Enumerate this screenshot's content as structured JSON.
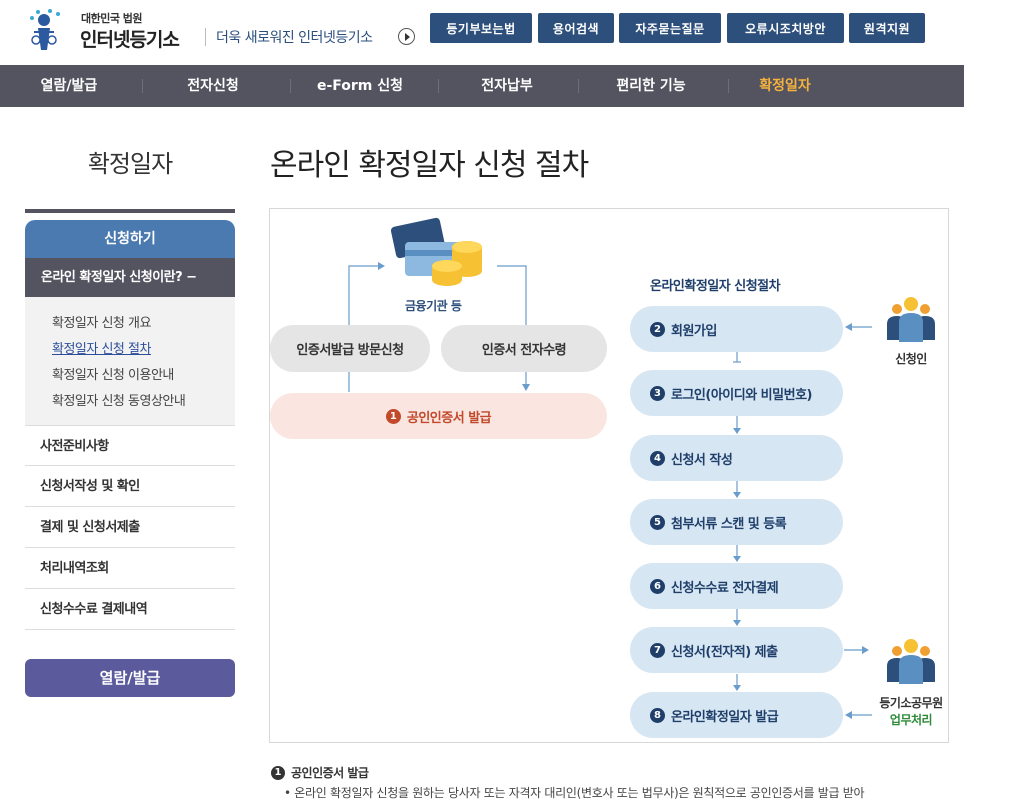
{
  "header": {
    "logo_small": "대한민국 법원",
    "logo_big": "인터넷등기소",
    "slogan": "더욱 새로워진 인터넷등기소",
    "top_buttons": [
      "등기부보는법",
      "용어검색",
      "자주묻는질문",
      "오류시조치방안",
      "원격지원"
    ]
  },
  "nav": {
    "items": [
      "열람/발급",
      "전자신청",
      "e-Form 신청",
      "전자납부",
      "편리한 기능",
      "확정일자"
    ],
    "active_index": 5
  },
  "sidebar": {
    "title": "확정일자",
    "apply_header": "신청하기",
    "active_item": "온라인 확정일자 신청이란? −",
    "sub_items": [
      "확정일자 신청 개요",
      "확정일자 신청 절차",
      "확정일자 신청 이용안내",
      "확정일자 신청 동영상안내"
    ],
    "current_sub_index": 1,
    "menu_items": [
      "사전준비사항",
      "신청서작성 및 확인",
      "결제 및 신청서제출",
      "처리내역조회",
      "신청수수료 결제내역"
    ],
    "view_button": "열람/발급"
  },
  "main": {
    "page_title": "온라인 확정일자 신청 절차",
    "diagram": {
      "financial_label": "금융기관 등",
      "left_pills": [
        "인증서발급 방문신청",
        "인증서 전자수령"
      ],
      "issue_step": {
        "num": "1",
        "label": "공인인증서 발급"
      },
      "process_title": "온라인확정일자 신청절차",
      "steps": [
        {
          "num": "2",
          "label": "회원가입"
        },
        {
          "num": "3",
          "label": "로그인(아이디와 비밀번호)"
        },
        {
          "num": "4",
          "label": "신청서 작성"
        },
        {
          "num": "5",
          "label": "첨부서류 스캔 및 등록"
        },
        {
          "num": "6",
          "label": "신청수수료 전자결제"
        },
        {
          "num": "7",
          "label": "신청서(전자적) 제출"
        },
        {
          "num": "8",
          "label": "온라인확정일자 발급"
        }
      ],
      "applicant_label": "신청인",
      "official_label": "등기소공무원",
      "official_sub": "업무처리"
    },
    "note": {
      "num": "1",
      "title": "공인인증서 발급",
      "body": "• 온라인 확정일자 신청을 원하는 당사자 또는 자격자 대리인(변호사 또는 법무사)은 원칙적으로 공인인증서를 발급 받아"
    }
  },
  "colors": {
    "nav_bg": "#545360",
    "nav_active": "#f5b33d",
    "top_button_bg": "#2d4f7b",
    "sidebar_apply_bg": "#4a7ab0",
    "sidebar_view_bg": "#5a5a9c",
    "step_bg": "#d7e6f3",
    "issue_bg": "#fbe5e1",
    "issue_text": "#c24a2b"
  }
}
